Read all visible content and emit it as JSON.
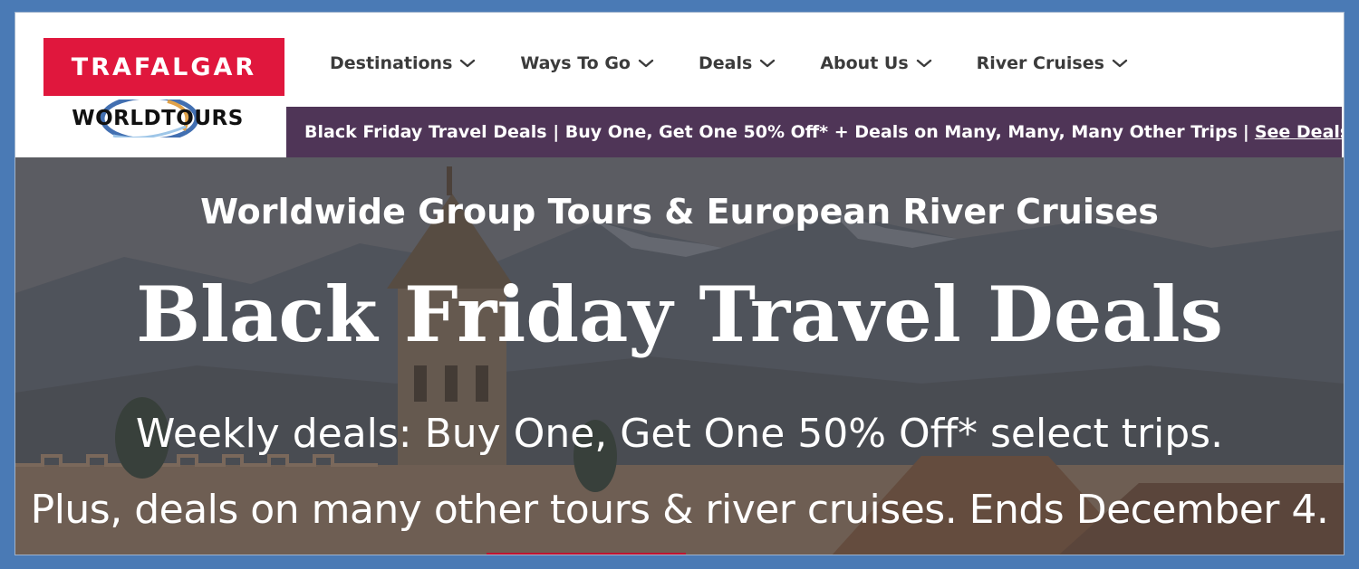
{
  "header": {
    "brand_logo": "TRAFALGAR",
    "partner_logo": "WORLDTOURS",
    "nav": [
      {
        "label": "Destinations"
      },
      {
        "label": "Ways To Go"
      },
      {
        "label": "Deals"
      },
      {
        "label": "About Us"
      },
      {
        "label": "River Cruises"
      }
    ]
  },
  "promo_bar": {
    "text": "Black Friday Travel Deals | Buy One, Get One 50% Off* + Deals on Many, Many, Many Other Trips",
    "separator": "|",
    "link": "See Deals >>"
  },
  "hero": {
    "subtitle": "Worldwide Group Tours & European River Cruises",
    "title": "Black Friday Travel Deals",
    "line1": "Weekly deals: Buy One, Get One 50% Off* select trips.",
    "line2": "Plus, deals on many other tours & river cruises. Ends December 4."
  },
  "colors": {
    "brand_red": "#e0173d",
    "promo_purple": "#4f3557",
    "page_blue": "#4a7ab5",
    "nav_text": "#3b3b3b"
  },
  "icons": {
    "nav_dropdown": "chevron-down-icon"
  }
}
